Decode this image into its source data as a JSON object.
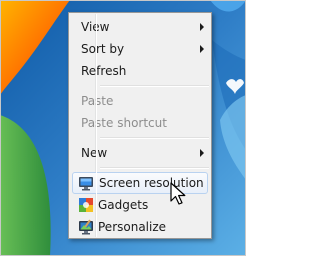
{
  "context_menu": {
    "items": [
      {
        "label": "View",
        "submenu": true,
        "enabled": true
      },
      {
        "label": "Sort by",
        "submenu": true,
        "enabled": true
      },
      {
        "label": "Refresh",
        "submenu": false,
        "enabled": true
      },
      {
        "label": "Paste",
        "submenu": false,
        "enabled": false
      },
      {
        "label": "Paste shortcut",
        "submenu": false,
        "enabled": false
      },
      {
        "label": "New",
        "submenu": true,
        "enabled": true
      },
      {
        "label": "Screen resolution",
        "icon": "screen-resolution-icon",
        "hovered": true
      },
      {
        "label": "Gadgets",
        "icon": "gadgets-icon"
      },
      {
        "label": "Personalize",
        "icon": "personalize-icon"
      }
    ]
  },
  "colors": {
    "desktop_sky": "#2f7ec7",
    "hover_border": "#b9d2f0",
    "disabled_text": "#8d8d8d"
  }
}
